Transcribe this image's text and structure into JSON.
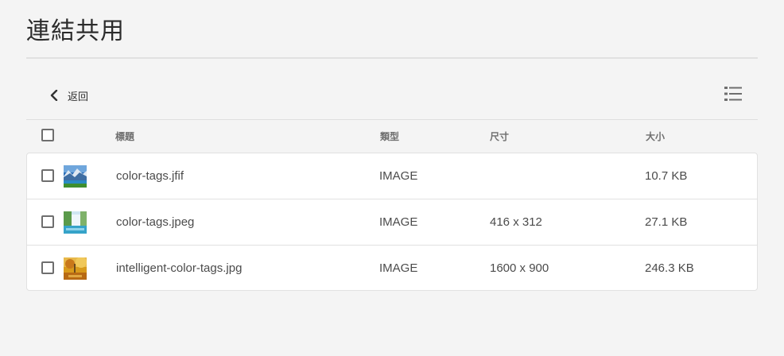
{
  "page": {
    "title": "連結共用"
  },
  "toolbar": {
    "back_label": "返回"
  },
  "table": {
    "headers": {
      "title": "標題",
      "type": "類型",
      "dimensions": "尺寸",
      "size": "大小"
    },
    "rows": [
      {
        "name": "color-tags.jfif",
        "type": "IMAGE",
        "dimensions": "",
        "size": "10.7 KB"
      },
      {
        "name": "color-tags.jpeg",
        "type": "IMAGE",
        "dimensions": "416 x 312",
        "size": "27.1 KB"
      },
      {
        "name": "intelligent-color-tags.jpg",
        "type": "IMAGE",
        "dimensions": "1600 x 900",
        "size": "246.3 KB"
      }
    ]
  },
  "icons": {
    "back": "chevron-left-icon",
    "view": "list-view-icon"
  },
  "colors": {
    "background": "#f4f4f4",
    "card": "#ffffff",
    "border": "#e1e1e1",
    "text": "#4b4b4b",
    "header_text": "#6e6e6e"
  }
}
